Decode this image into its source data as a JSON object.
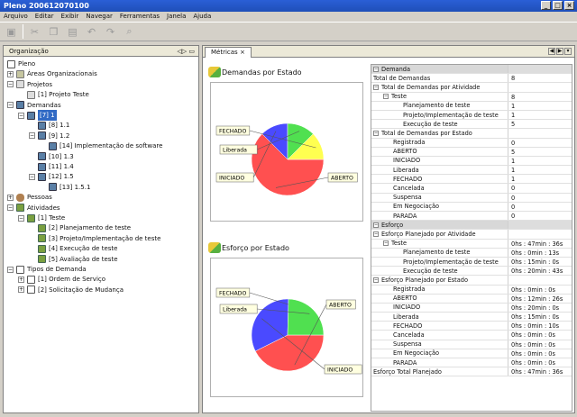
{
  "window": {
    "title": "Pleno 200612070100"
  },
  "menu": [
    "Arquivo",
    "Editar",
    "Exibir",
    "Navegar",
    "Ferramentas",
    "Janela",
    "Ajuda"
  ],
  "left_panel": {
    "tab": "Organização",
    "tree": [
      {
        "label": "Pleno",
        "indent": 0,
        "icon": "page",
        "exp": ""
      },
      {
        "label": "Áreas Organizacionais",
        "indent": 0,
        "icon": "org",
        "exp": "+"
      },
      {
        "label": "Projetos",
        "indent": 0,
        "icon": "proj",
        "exp": "−"
      },
      {
        "label": "[1] Projeto Teste",
        "indent": 1,
        "icon": "proj",
        "exp": ""
      },
      {
        "label": "Demandas",
        "indent": 0,
        "icon": "dem",
        "exp": "−"
      },
      {
        "label": "[7] 1",
        "indent": 1,
        "icon": "dem",
        "exp": "−",
        "selected": true
      },
      {
        "label": "[8] 1.1",
        "indent": 2,
        "icon": "dem",
        "exp": ""
      },
      {
        "label": "[9] 1.2",
        "indent": 2,
        "icon": "dem",
        "exp": "−"
      },
      {
        "label": "[14] Implementação de software",
        "indent": 3,
        "icon": "dem",
        "exp": ""
      },
      {
        "label": "[10] 1.3",
        "indent": 2,
        "icon": "dem",
        "exp": ""
      },
      {
        "label": "[11] 1.4",
        "indent": 2,
        "icon": "dem",
        "exp": ""
      },
      {
        "label": "[12] 1.5",
        "indent": 2,
        "icon": "dem",
        "exp": "−"
      },
      {
        "label": "[13] 1.5.1",
        "indent": 3,
        "icon": "dem",
        "exp": ""
      },
      {
        "label": "Pessoas",
        "indent": 0,
        "icon": "pes",
        "exp": "+"
      },
      {
        "label": "Atividades",
        "indent": 0,
        "icon": "atv",
        "exp": "−"
      },
      {
        "label": "[1] Teste",
        "indent": 1,
        "icon": "atv",
        "exp": "−"
      },
      {
        "label": "[2] Planejamento de teste",
        "indent": 2,
        "icon": "atv",
        "exp": ""
      },
      {
        "label": "[3] Projeto/Implementação de teste",
        "indent": 2,
        "icon": "atv",
        "exp": ""
      },
      {
        "label": "[4] Execução de teste",
        "indent": 2,
        "icon": "atv",
        "exp": ""
      },
      {
        "label": "[5] Avaliação de teste",
        "indent": 2,
        "icon": "atv",
        "exp": ""
      },
      {
        "label": "Tipos de Demanda",
        "indent": 0,
        "icon": "tip",
        "exp": "−"
      },
      {
        "label": "[1] Ordem de Serviço",
        "indent": 1,
        "icon": "tip",
        "exp": "+"
      },
      {
        "label": "[2] Solicitação de Mudança",
        "indent": 1,
        "icon": "tip",
        "exp": "+"
      }
    ]
  },
  "right_panel": {
    "tab": "Métricas"
  },
  "chart_data": [
    {
      "type": "pie",
      "title": "Demandas por Estado",
      "categories": [
        "ABERTO",
        "INICIADO",
        "Liberada",
        "FECHADO"
      ],
      "values": [
        5,
        1,
        1,
        1
      ],
      "colors": [
        "#ff5050",
        "#4a4aff",
        "#50e050",
        "#ffff50"
      ]
    },
    {
      "type": "pie",
      "title": "Esforço por Estado",
      "categories": [
        "ABERTO",
        "INICIADO",
        "FECHADO",
        "Liberada"
      ],
      "values": [
        26,
        20,
        0,
        15
      ],
      "colors": [
        "#ff5050",
        "#4a4aff",
        "#ffff50",
        "#50e050"
      ]
    }
  ],
  "metrics_table": [
    {
      "k": "Demanda",
      "v": "",
      "indent": 0,
      "section": true
    },
    {
      "k": "Total de Demandas",
      "v": "8",
      "indent": 0
    },
    {
      "k": "Total de Demandas por Atividade",
      "v": "",
      "indent": 0,
      "exp": "−"
    },
    {
      "k": "Teste",
      "v": "8",
      "indent": 1,
      "exp": "−"
    },
    {
      "k": "Planejamento de teste",
      "v": "1",
      "indent": 3
    },
    {
      "k": "Projeto/Implementação de teste",
      "v": "1",
      "indent": 3
    },
    {
      "k": "Execução de teste",
      "v": "5",
      "indent": 3
    },
    {
      "k": "Total de Demandas por Estado",
      "v": "",
      "indent": 0,
      "exp": "−"
    },
    {
      "k": "Registrada",
      "v": "0",
      "indent": 2
    },
    {
      "k": "ABERTO",
      "v": "5",
      "indent": 2
    },
    {
      "k": "INICIADO",
      "v": "1",
      "indent": 2
    },
    {
      "k": "Liberada",
      "v": "1",
      "indent": 2
    },
    {
      "k": "FECHADO",
      "v": "1",
      "indent": 2
    },
    {
      "k": "Cancelada",
      "v": "0",
      "indent": 2
    },
    {
      "k": "Suspensa",
      "v": "0",
      "indent": 2
    },
    {
      "k": "Em Negociação",
      "v": "0",
      "indent": 2
    },
    {
      "k": "PARADA",
      "v": "0",
      "indent": 2
    },
    {
      "k": "Esforço",
      "v": "",
      "indent": 0,
      "section": true
    },
    {
      "k": "Esforço Planejado por Atividade",
      "v": "",
      "indent": 0,
      "exp": "−"
    },
    {
      "k": "Teste",
      "v": "0hs : 47min : 36s",
      "indent": 1,
      "exp": "−"
    },
    {
      "k": "Planejamento de teste",
      "v": "0hs : 0min : 13s",
      "indent": 3
    },
    {
      "k": "Projeto/Implementação de teste",
      "v": "0hs : 15min : 0s",
      "indent": 3
    },
    {
      "k": "Execução de teste",
      "v": "0hs : 20min : 43s",
      "indent": 3
    },
    {
      "k": "Esforço Planejado por Estado",
      "v": "",
      "indent": 0,
      "exp": "−"
    },
    {
      "k": "Registrada",
      "v": "0hs : 0min : 0s",
      "indent": 2
    },
    {
      "k": "ABERTO",
      "v": "0hs : 12min : 26s",
      "indent": 2
    },
    {
      "k": "INICIADO",
      "v": "0hs : 20min : 0s",
      "indent": 2
    },
    {
      "k": "Liberada",
      "v": "0hs : 15min : 0s",
      "indent": 2
    },
    {
      "k": "FECHADO",
      "v": "0hs : 0min : 10s",
      "indent": 2
    },
    {
      "k": "Cancelada",
      "v": "0hs : 0min : 0s",
      "indent": 2
    },
    {
      "k": "Suspensa",
      "v": "0hs : 0min : 0s",
      "indent": 2
    },
    {
      "k": "Em Negociação",
      "v": "0hs : 0min : 0s",
      "indent": 2
    },
    {
      "k": "PARADA",
      "v": "0hs : 0min : 0s",
      "indent": 2
    },
    {
      "k": "Esforço Total Planejado",
      "v": "0hs : 47min : 36s",
      "indent": 0
    }
  ]
}
